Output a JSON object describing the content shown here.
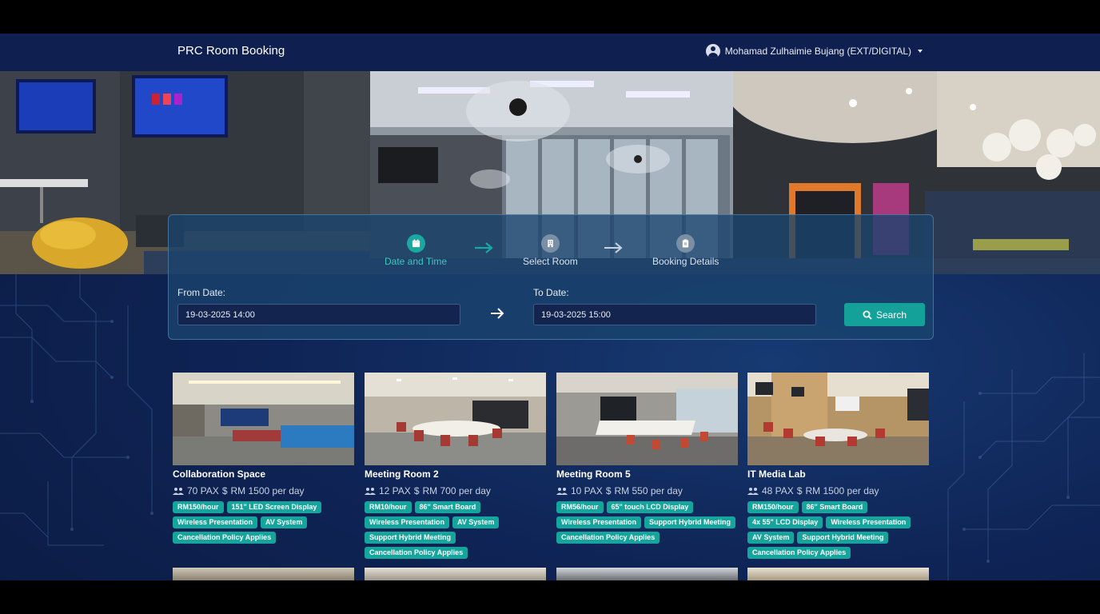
{
  "app": {
    "brand": "PRC Room Booking"
  },
  "user": {
    "name": "Mohamad Zulhaimie Bujang (EXT/DIGITAL)"
  },
  "steps": [
    {
      "label": "Date and Time",
      "icon": "calendar-icon",
      "active": true
    },
    {
      "label": "Select Room",
      "icon": "building-icon",
      "active": false
    },
    {
      "label": "Booking Details",
      "icon": "clipboard-icon",
      "active": false
    }
  ],
  "booking": {
    "from_label": "From Date:",
    "from_value": "19-03-2025 14:00",
    "to_label": "To Date:",
    "to_value": "19-03-2025 15:00",
    "search_label": "Search"
  },
  "colors": {
    "accent": "#14a19a",
    "navbar": "#0f2050",
    "panel": "#1a446e"
  },
  "rooms": [
    {
      "name": "Collaboration Space",
      "capacity": "70 PAX",
      "price": "RM 1500 per day",
      "tags": [
        "RM150/hour",
        "151\" LED Screen Display",
        "Wireless Presentation",
        "AV System",
        "Cancellation Policy Applies"
      ]
    },
    {
      "name": "Meeting Room 2",
      "capacity": "12 PAX",
      "price": "RM 700 per day",
      "tags": [
        "RM10/hour",
        "86\" Smart Board",
        "Wireless Presentation",
        "AV System",
        "Support Hybrid Meeting",
        "Cancellation Policy Applies"
      ]
    },
    {
      "name": "Meeting Room 5",
      "capacity": "10 PAX",
      "price": "RM 550 per day",
      "tags": [
        "RM56/hour",
        "65\" touch LCD Display",
        "Wireless Presentation",
        "Support Hybrid Meeting",
        "Cancellation Policy Applies"
      ]
    },
    {
      "name": "IT Media Lab",
      "capacity": "48 PAX",
      "price": "RM 1500 per day",
      "tags": [
        "RM150/hour",
        "86\" Smart Board",
        "4x 55\" LCD Display",
        "Wireless Presentation",
        "AV System",
        "Support Hybrid Meeting",
        "Cancellation Policy Applies"
      ]
    }
  ]
}
